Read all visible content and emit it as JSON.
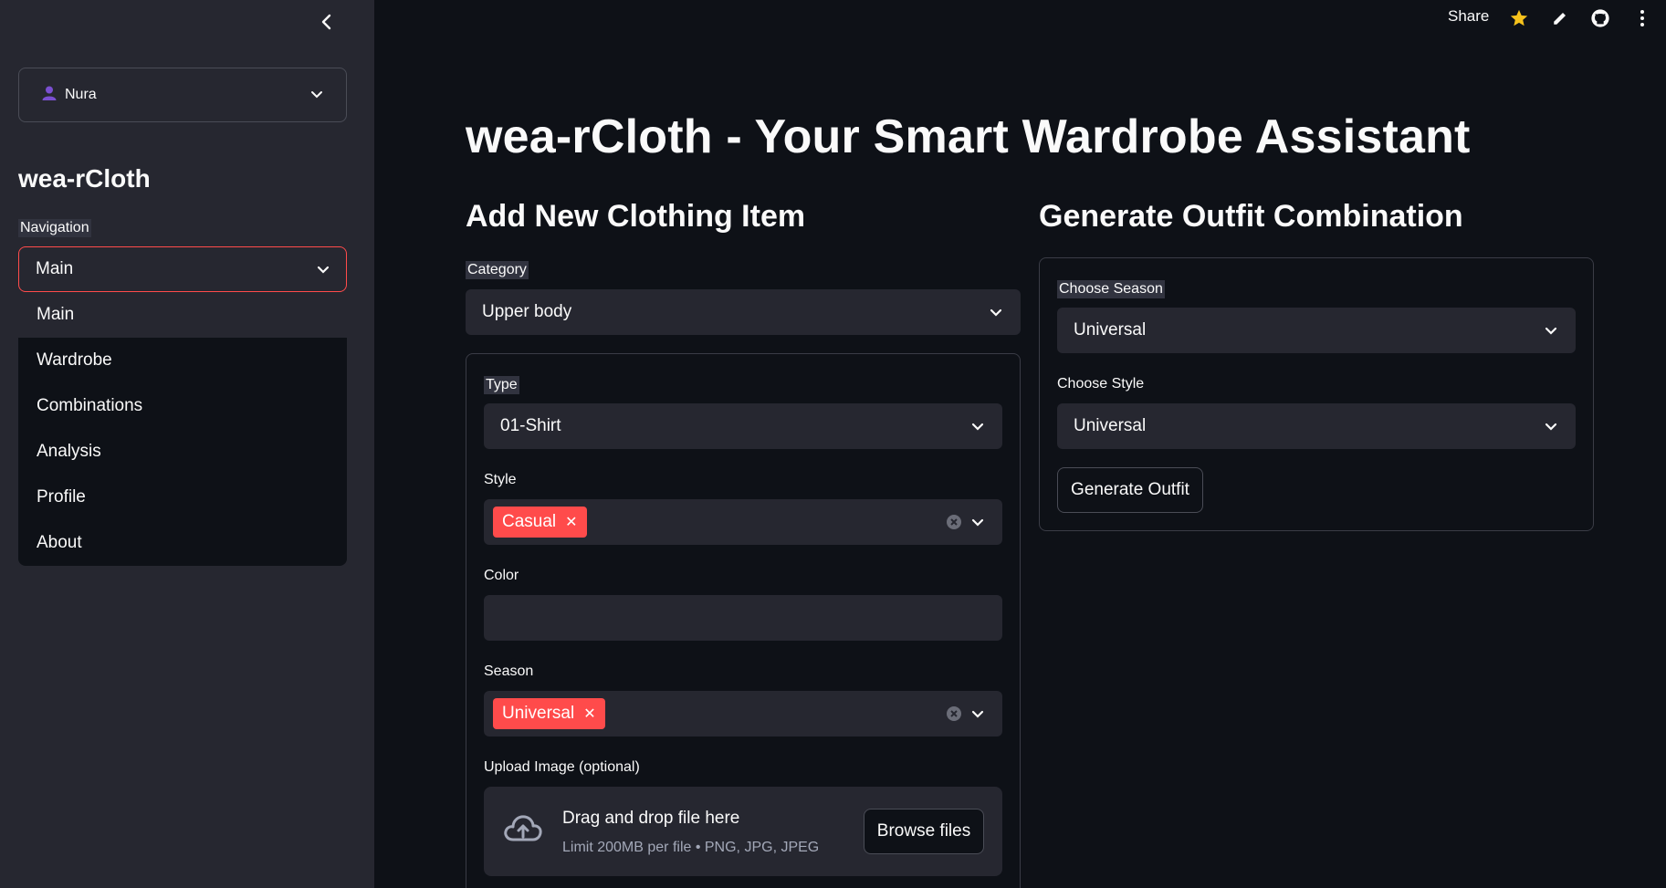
{
  "sidebar": {
    "user": {
      "name": "Nura",
      "icon": "user-icon"
    },
    "app_title": "wea-rCloth",
    "nav_label": "Navigation",
    "nav_selected": "Main",
    "nav_options": [
      "Main",
      "Wardrobe",
      "Combinations",
      "Analysis",
      "Profile",
      "About"
    ]
  },
  "topbar": {
    "share_label": "Share",
    "icons": [
      "star-icon",
      "pencil-icon",
      "github-icon",
      "more-vert-icon"
    ]
  },
  "main": {
    "title": "wea-rCloth - Your Smart Wardrobe Assistant",
    "add_item": {
      "heading": "Add New Clothing Item",
      "category_label": "Category",
      "category_value": "Upper body",
      "type_label": "Type",
      "type_value": "01-Shirt",
      "style_label": "Style",
      "style_tags": [
        "Casual"
      ],
      "color_label": "Color",
      "color_value": "",
      "season_label": "Season",
      "season_tags": [
        "Universal"
      ],
      "upload_label": "Upload Image (optional)",
      "upload_title": "Drag and drop file here",
      "upload_sub": "Limit 200MB per file • PNG, JPG, JPEG",
      "browse_label": "Browse files"
    },
    "outfit": {
      "heading": "Generate Outfit Combination",
      "season_label": "Choose Season",
      "season_value": "Universal",
      "style_label": "Choose Style",
      "style_value": "Universal",
      "generate_label": "Generate Outfit"
    }
  },
  "colors": {
    "accent": "#ff4b4b",
    "sidebar_bg": "#262730",
    "app_bg": "#0e1117",
    "star": "#f6c21c"
  }
}
